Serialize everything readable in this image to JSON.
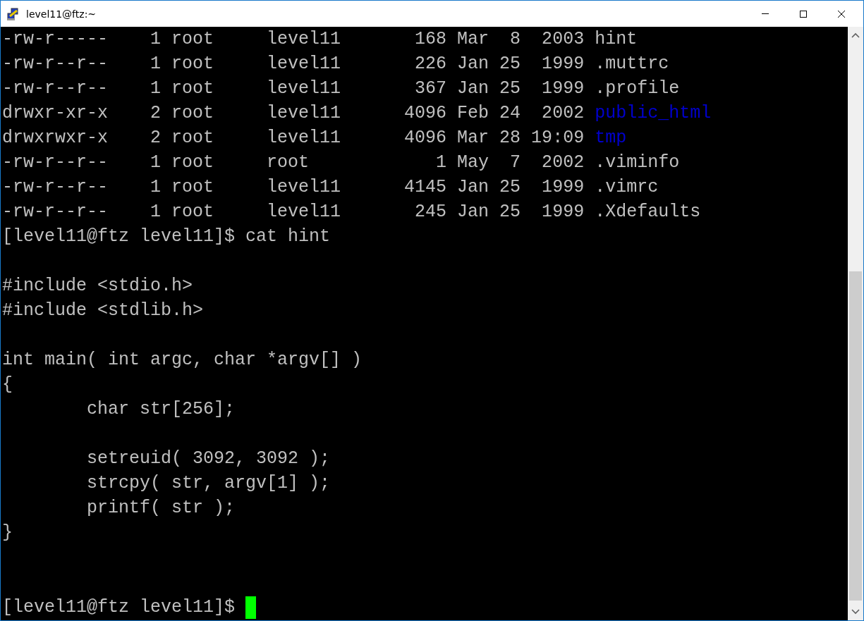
{
  "window": {
    "title": "level11@ftz:~"
  },
  "terminal": {
    "blocks": [
      {
        "lines": [
          {
            "segments": [
              {
                "text": "-rw-r-----    1 root     level11       168 Mar  8  2003 hint",
                "kind": "plain"
              }
            ]
          },
          {
            "segments": [
              {
                "text": "-rw-r--r--    1 root     level11       226 Jan 25  1999 .muttrc",
                "kind": "plain"
              }
            ]
          },
          {
            "segments": [
              {
                "text": "-rw-r--r--    1 root     level11       367 Jan 25  1999 .profile",
                "kind": "plain"
              }
            ]
          },
          {
            "segments": [
              {
                "text": "drwxr-xr-x    2 root     level11      4096 Feb 24  2002 ",
                "kind": "plain"
              },
              {
                "text": "public_html",
                "kind": "directory"
              }
            ]
          },
          {
            "segments": [
              {
                "text": "drwxrwxr-x    2 root     level11      4096 Mar 28 19:09 ",
                "kind": "plain"
              },
              {
                "text": "tmp",
                "kind": "directory"
              }
            ]
          },
          {
            "segments": [
              {
                "text": "-rw-r--r--    1 root     root            1 May  7  2002 .viminfo",
                "kind": "plain"
              }
            ]
          },
          {
            "segments": [
              {
                "text": "-rw-r--r--    1 root     level11      4145 Jan 25  1999 .vimrc",
                "kind": "plain"
              }
            ]
          },
          {
            "segments": [
              {
                "text": "-rw-r--r--    1 root     level11       245 Jan 25  1999 .Xdefaults",
                "kind": "plain"
              }
            ]
          },
          {
            "segments": [
              {
                "text": "[level11@ftz level11]$ cat hint",
                "kind": "plain"
              }
            ]
          }
        ]
      },
      {
        "lines": [
          {
            "segments": [
              {
                "text": "#include <stdio.h>",
                "kind": "plain"
              }
            ]
          },
          {
            "segments": [
              {
                "text": "#include <stdlib.h>",
                "kind": "plain"
              }
            ]
          }
        ]
      },
      {
        "lines": [
          {
            "segments": [
              {
                "text": "int main( int argc, char *argv[] )",
                "kind": "plain"
              }
            ]
          },
          {
            "segments": [
              {
                "text": "{",
                "kind": "plain"
              }
            ]
          },
          {
            "segments": [
              {
                "text": "        char str[256];",
                "kind": "plain"
              }
            ]
          }
        ]
      },
      {
        "lines": [
          {
            "segments": [
              {
                "text": "        setreuid( 3092, 3092 );",
                "kind": "plain"
              }
            ]
          },
          {
            "segments": [
              {
                "text": "        strcpy( str, argv[1] );",
                "kind": "plain"
              }
            ]
          },
          {
            "segments": [
              {
                "text": "        printf( str );",
                "kind": "plain"
              }
            ]
          },
          {
            "segments": [
              {
                "text": "}",
                "kind": "plain"
              }
            ]
          }
        ]
      },
      {
        "pinned_bottom": true,
        "lines": [
          {
            "segments": [
              {
                "text": "[level11@ftz level11]$ ",
                "kind": "plain"
              }
            ],
            "cursor": true
          }
        ]
      }
    ]
  }
}
